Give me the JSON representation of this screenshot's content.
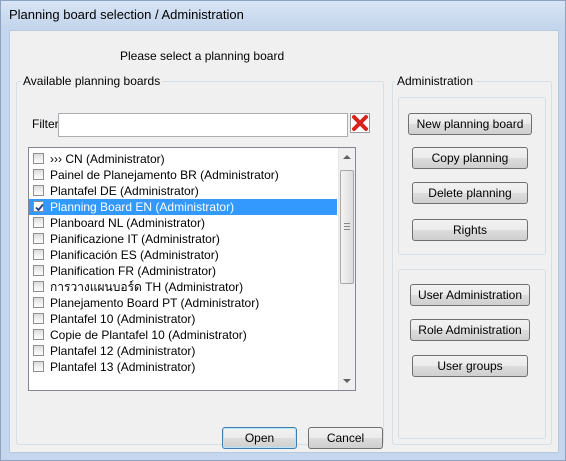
{
  "window": {
    "title": "Planning board selection / Administration"
  },
  "prompt": "Please select a planning board",
  "available": {
    "group_label": "Available planning boards",
    "filter_label": "Filter",
    "filter_value": "",
    "items": [
      {
        "label": "››› CN (Administrator)",
        "checked": false,
        "selected": false
      },
      {
        "label": "Painel de Planejamento BR (Administrator)",
        "checked": false,
        "selected": false
      },
      {
        "label": "Plantafel DE (Administrator)",
        "checked": false,
        "selected": false
      },
      {
        "label": "Planning Board EN (Administrator)",
        "checked": true,
        "selected": true
      },
      {
        "label": "Planboard NL (Administrator)",
        "checked": false,
        "selected": false
      },
      {
        "label": "Pianificazione IT (Administrator)",
        "checked": false,
        "selected": false
      },
      {
        "label": "Planificación ES (Administrator)",
        "checked": false,
        "selected": false
      },
      {
        "label": "Planification FR (Administrator)",
        "checked": false,
        "selected": false
      },
      {
        "label": "การวางแผนบอร์ด TH (Administrator)",
        "checked": false,
        "selected": false
      },
      {
        "label": "Planejamento Board PT (Administrator)",
        "checked": false,
        "selected": false
      },
      {
        "label": "Plantafel 10 (Administrator)",
        "checked": false,
        "selected": false
      },
      {
        "label": "Copie de Plantafel 10 (Administrator)",
        "checked": false,
        "selected": false
      },
      {
        "label": "Plantafel 12 (Administrator)",
        "checked": false,
        "selected": false
      },
      {
        "label": "Plantafel 13 (Administrator)",
        "checked": false,
        "selected": false
      }
    ]
  },
  "administration": {
    "group_label": "Administration",
    "new_planning_board": "New planning board",
    "copy_planning": "Copy planning",
    "delete_planning": "Delete planning",
    "rights": "Rights",
    "user_administration": "User Administration",
    "role_administration": "Role Administration",
    "user_groups": "User groups"
  },
  "footer": {
    "open": "Open",
    "cancel": "Cancel"
  },
  "icons": {
    "clear_filter": "red-x-icon",
    "check": "check-icon"
  },
  "colors": {
    "selection": "#3399ff",
    "clear_icon": "#d8231f"
  }
}
